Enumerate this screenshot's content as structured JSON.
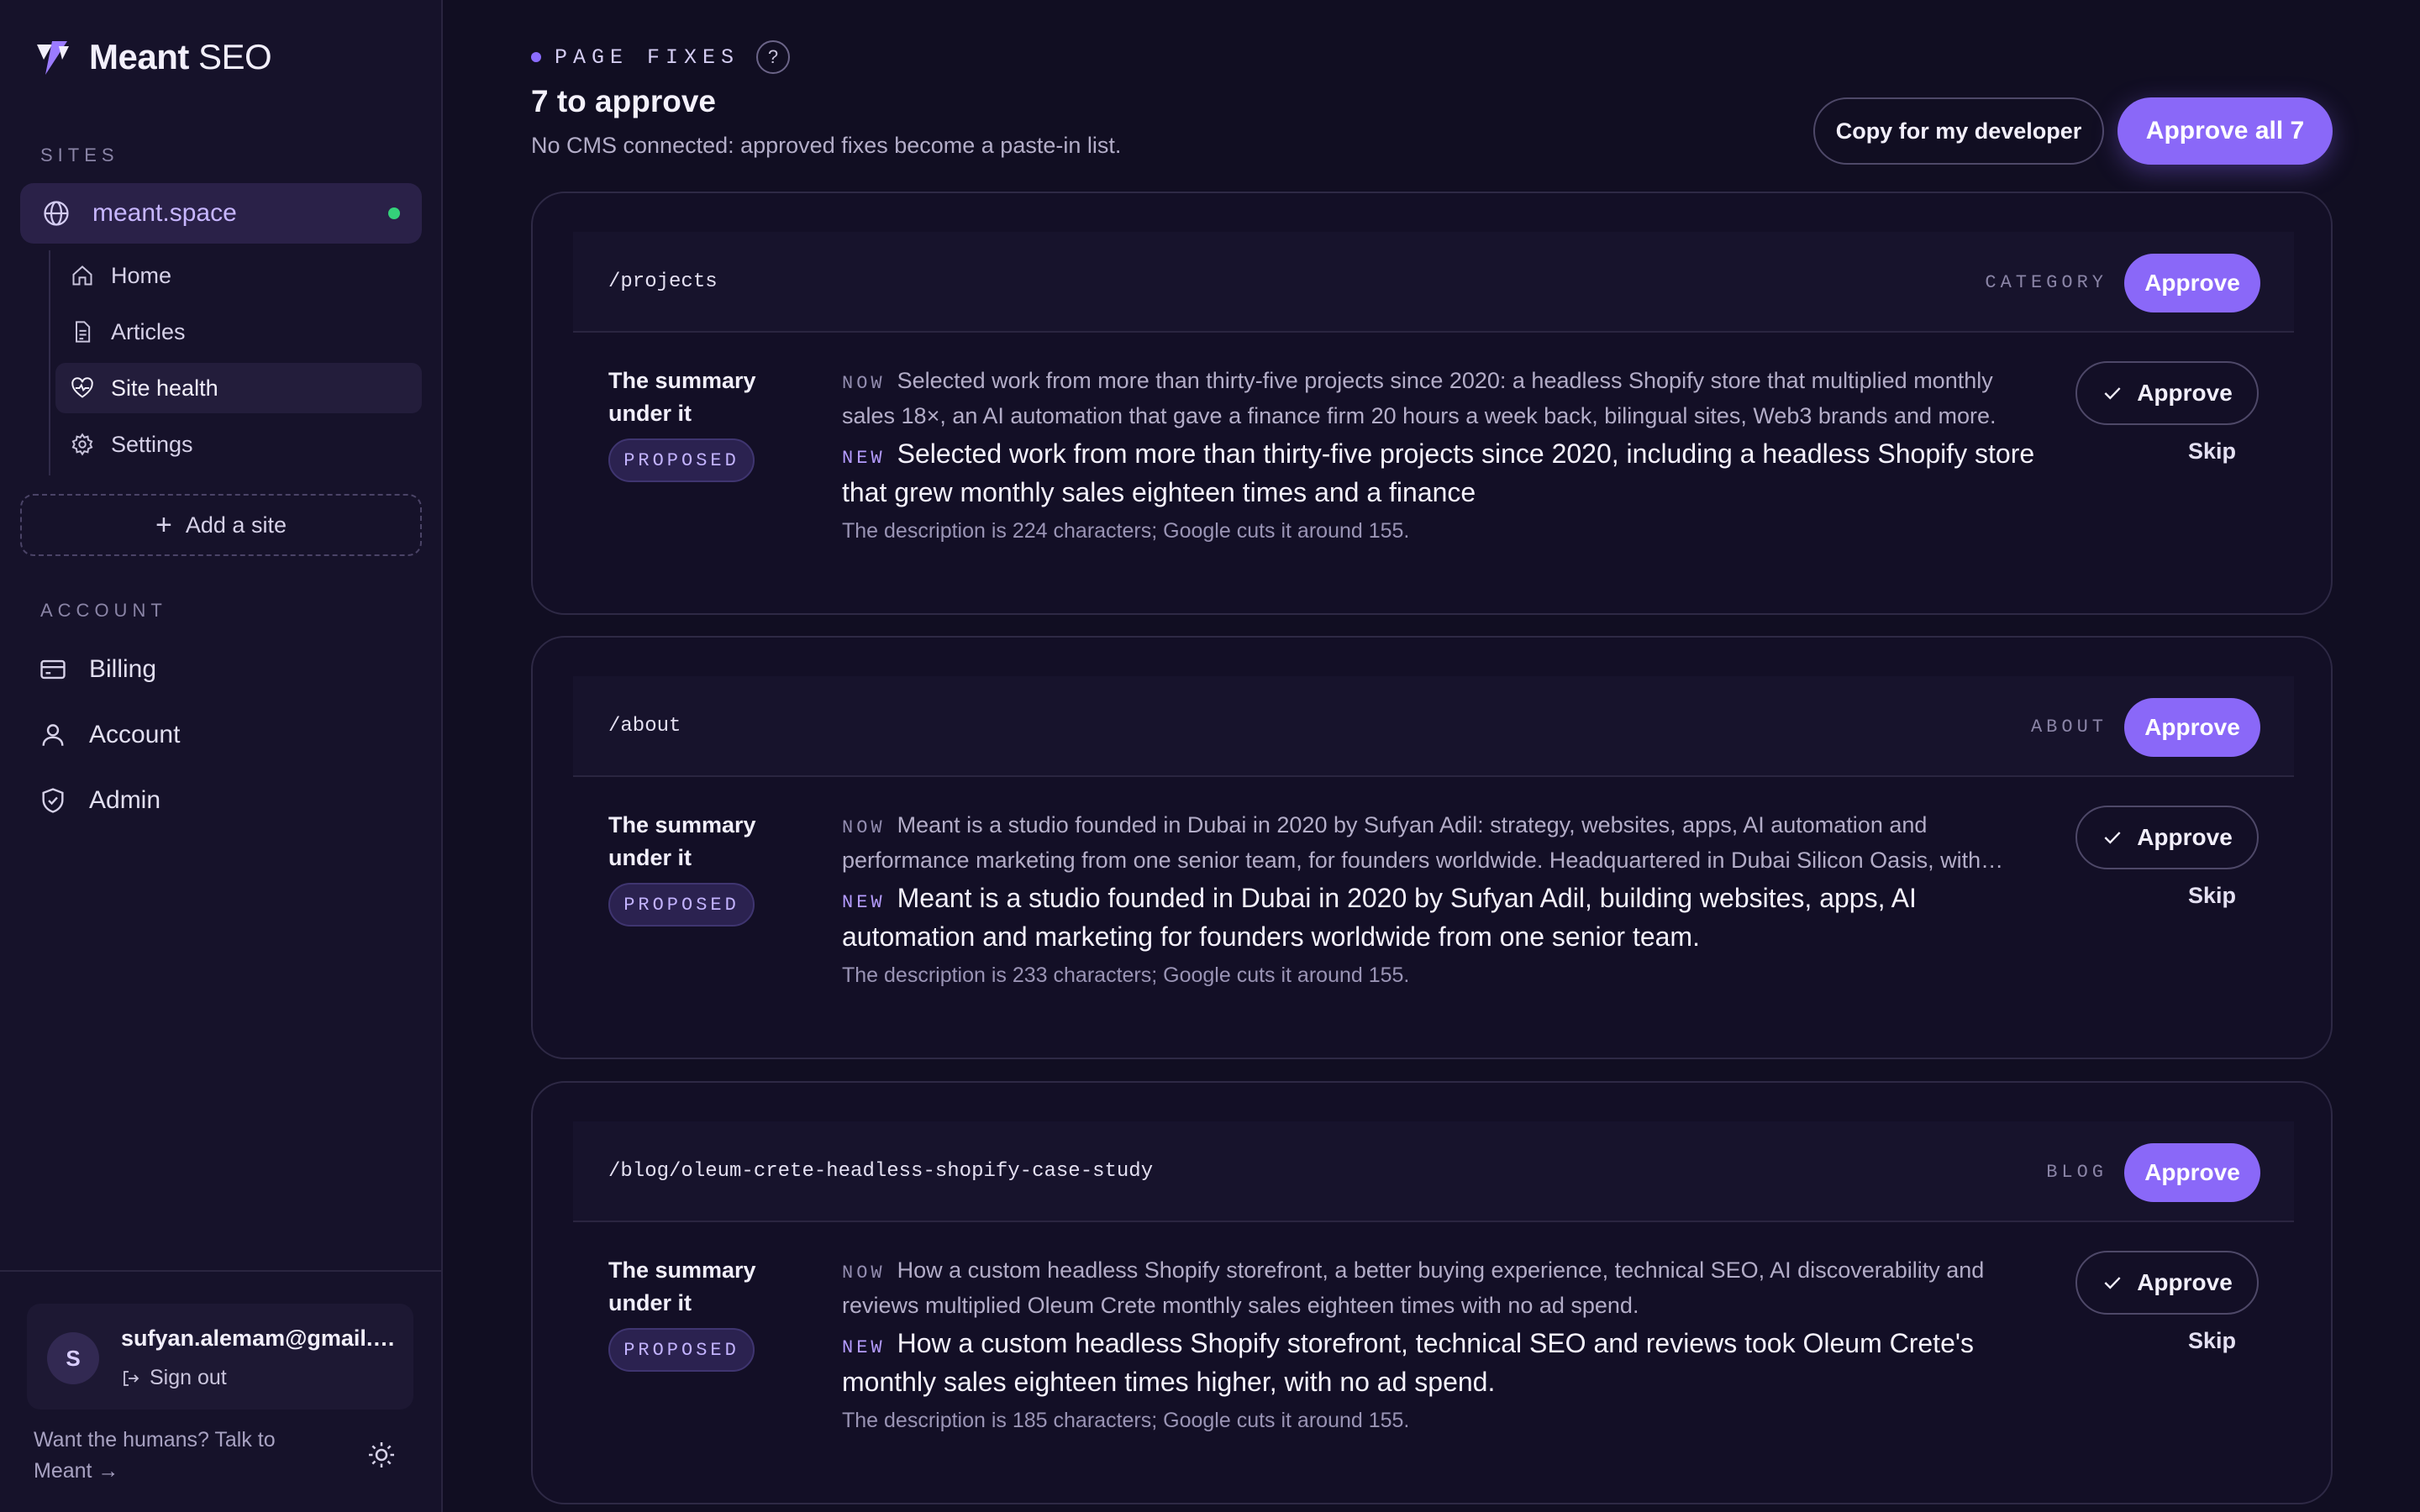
{
  "brand": {
    "name_bold": "Meant",
    "name_light": " SEO"
  },
  "sidebar": {
    "sites_label": "SITES",
    "site": {
      "name": "meant.space",
      "status_color": "#34d27a"
    },
    "subnav": [
      {
        "label": "Home",
        "icon": "home-icon"
      },
      {
        "label": "Articles",
        "icon": "document-icon"
      },
      {
        "label": "Site health",
        "icon": "heart-pulse-icon",
        "active": true
      },
      {
        "label": "Settings",
        "icon": "gear-icon"
      }
    ],
    "add_site": "Add a site",
    "account_label": "ACCOUNT",
    "account_items": [
      {
        "label": "Billing",
        "icon": "credit-card-icon"
      },
      {
        "label": "Account",
        "icon": "user-icon"
      },
      {
        "label": "Admin",
        "icon": "shield-icon"
      }
    ],
    "user": {
      "initial": "S",
      "email": "sufyan.alemam@gmail.com",
      "signout": "Sign out"
    },
    "talk": "Want the humans? Talk to Meant →"
  },
  "header": {
    "section": "PAGE FIXES",
    "help": "?",
    "title": "7 to approve",
    "subtitle": "No CMS connected: approved fixes become a paste-in list.",
    "copy_btn": "Copy for my developer",
    "approve_all_btn": "Approve all 7"
  },
  "labels": {
    "approve": "Approve",
    "skip": "Skip",
    "now": "NOW",
    "new": "NEW",
    "proposed": "PROPOSED",
    "field": "The summary under it"
  },
  "fixes": [
    {
      "path": "/projects",
      "category": "CATEGORY",
      "now": "Selected work from more than thirty-five projects since 2020: a headless Shopify store that multiplied monthly sales 18×, an AI automation that gave a finance firm 20 hours a week back, bilingual sites, Web3 brands and more.",
      "new": "Selected work from more than thirty-five projects since 2020, including a headless Shopify store that grew monthly sales eighteen times and a finance",
      "note": "The description is 224 characters; Google cuts it around 155."
    },
    {
      "path": "/about",
      "category": "ABOUT",
      "now": "Meant is a studio founded in Dubai in 2020 by Sufyan Adil: strategy, websites, apps, AI automation and performance marketing from one senior team, for founders worldwide. Headquartered in Dubai Silicon Oasis, with offices in Istanbul and Berlin.",
      "new": "Meant is a studio founded in Dubai in 2020 by Sufyan Adil, building websites, apps, AI automation and marketing for founders worldwide from one senior team.",
      "note": "The description is 233 characters; Google cuts it around 155."
    },
    {
      "path": "/blog/oleum-crete-headless-shopify-case-study",
      "category": "BLOG",
      "now": "How a custom headless Shopify storefront, a better buying experience, technical SEO, AI discoverability and reviews multiplied Oleum Crete monthly sales eighteen times with no ad spend.",
      "new": "How a custom headless Shopify storefront, technical SEO and reviews took Oleum Crete's monthly sales eighteen times higher, with no ad spend.",
      "note": "The description is 185 characters; Google cuts it around 155."
    }
  ]
}
